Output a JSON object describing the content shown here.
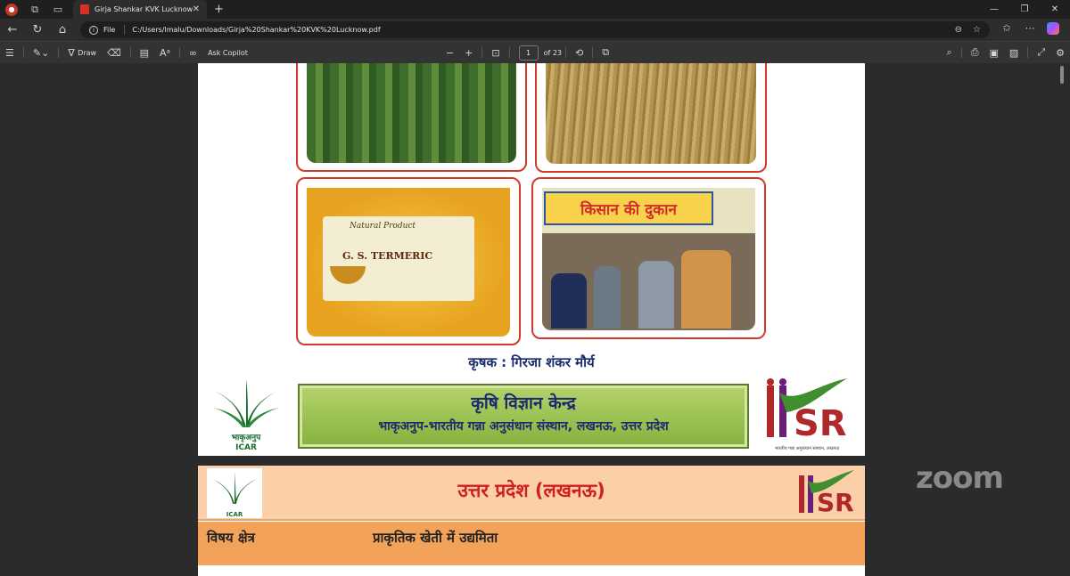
{
  "browser": {
    "tab_title": "Girja Shankar KVK Lucknow.pdf",
    "scheme": "File",
    "url": "C:/Users/lmalu/Downloads/Girja%20Shankar%20KVK%20Lucknow.pdf"
  },
  "pdf_toolbar": {
    "draw_label": "Draw",
    "ask_copilot_label": "Ask Copilot",
    "current_page": "1",
    "page_total": "of 23"
  },
  "page1": {
    "photo3": {
      "brand": "Natural Product",
      "product": "G. S. TERMERIC"
    },
    "photo4": {
      "shop_sign": "किसान की दुकान"
    },
    "farmer_line": "कृषक : गिरजा शंकर मौर्य",
    "kvk_title": "कृषि विज्ञान केन्द्र",
    "kvk_subtitle": "भाकृअनुप-भारतीय गन्ना अनुसंधान संस्थान, लखनऊ, उत्तर प्रदेश",
    "icar_text": "भाकृअनुप",
    "icar_en": "ICAR",
    "iisr_caption": "भारतीय गन्ना अनुसंधान संस्थान, लखनऊ"
  },
  "page2": {
    "title": "उत्तर प्रदेश (लखनऊ)",
    "row_key": "विषय क्षेत्र",
    "row_value": "प्राकृतिक खेती में उद्यमिता"
  },
  "watermark": {
    "zoom": "zoom"
  },
  "colors": {
    "accent_red": "#d23a2a",
    "banner_green": "#86b13e",
    "navy_text": "#1c2a6e",
    "peach": "#fbd0a8",
    "orange": "#f3a25a"
  }
}
